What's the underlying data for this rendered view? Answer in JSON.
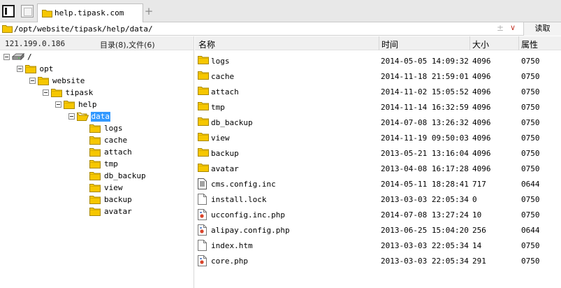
{
  "tab": {
    "title": "help.tipask.com",
    "add_label": "+"
  },
  "address": {
    "path": "/opt/website/tipask/help/data/",
    "pm_icon": "plus-minus-icon",
    "dropdown_icon": "chevron-down-icon",
    "read_label": "读取"
  },
  "left": {
    "ip": "121.199.0.186",
    "counts": "目录(8),文件(6)",
    "tree": [
      {
        "label": "/",
        "level": 0,
        "toggle": true,
        "icon": "drive"
      },
      {
        "label": "opt",
        "level": 1,
        "toggle": true,
        "icon": "folder"
      },
      {
        "label": "website",
        "level": 2,
        "toggle": true,
        "icon": "folder"
      },
      {
        "label": "tipask",
        "level": 3,
        "toggle": true,
        "icon": "folder"
      },
      {
        "label": "help",
        "level": 4,
        "toggle": true,
        "icon": "folder"
      },
      {
        "label": "data",
        "level": 5,
        "toggle": true,
        "icon": "folder-open",
        "selected": true
      },
      {
        "label": "logs",
        "level": 6,
        "toggle": false,
        "icon": "folder"
      },
      {
        "label": "cache",
        "level": 6,
        "toggle": false,
        "icon": "folder"
      },
      {
        "label": "attach",
        "level": 6,
        "toggle": false,
        "icon": "folder"
      },
      {
        "label": "tmp",
        "level": 6,
        "toggle": false,
        "icon": "folder"
      },
      {
        "label": "db_backup",
        "level": 6,
        "toggle": false,
        "icon": "folder"
      },
      {
        "label": "view",
        "level": 6,
        "toggle": false,
        "icon": "folder"
      },
      {
        "label": "backup",
        "level": 6,
        "toggle": false,
        "icon": "folder"
      },
      {
        "label": "avatar",
        "level": 6,
        "toggle": false,
        "icon": "folder"
      }
    ]
  },
  "table": {
    "headers": {
      "name": "名称",
      "time": "时间",
      "size": "大小",
      "attr": "属性"
    },
    "rows": [
      {
        "name": "logs",
        "time": "2014-05-05 14:09:32",
        "size": "4096",
        "attr": "0750",
        "icon": "folder"
      },
      {
        "name": "cache",
        "time": "2014-11-18 21:59:01",
        "size": "4096",
        "attr": "0750",
        "icon": "folder"
      },
      {
        "name": "attach",
        "time": "2014-11-02 15:05:52",
        "size": "4096",
        "attr": "0750",
        "icon": "folder"
      },
      {
        "name": "tmp",
        "time": "2014-11-14 16:32:59",
        "size": "4096",
        "attr": "0750",
        "icon": "folder"
      },
      {
        "name": "db_backup",
        "time": "2014-07-08 13:26:32",
        "size": "4096",
        "attr": "0750",
        "icon": "folder"
      },
      {
        "name": "view",
        "time": "2014-11-19 09:50:03",
        "size": "4096",
        "attr": "0750",
        "icon": "folder"
      },
      {
        "name": "backup",
        "time": "2013-05-21 13:16:04",
        "size": "4096",
        "attr": "0750",
        "icon": "folder"
      },
      {
        "name": "avatar",
        "time": "2013-04-08 16:17:28",
        "size": "4096",
        "attr": "0750",
        "icon": "folder"
      },
      {
        "name": "cms.config.inc",
        "time": "2014-05-11 18:28:41",
        "size": "717",
        "attr": "0644",
        "icon": "config-file"
      },
      {
        "name": "install.lock",
        "time": "2013-03-03 22:05:34",
        "size": "0",
        "attr": "0750",
        "icon": "blank-file"
      },
      {
        "name": "ucconfig.inc.php",
        "time": "2014-07-08 13:27:24",
        "size": "10",
        "attr": "0750",
        "icon": "php-file"
      },
      {
        "name": "alipay.config.php",
        "time": "2013-06-25 15:04:20",
        "size": "256",
        "attr": "0644",
        "icon": "php-file"
      },
      {
        "name": "index.htm",
        "time": "2013-03-03 22:05:34",
        "size": "14",
        "attr": "0750",
        "icon": "blank-file"
      },
      {
        "name": "core.php",
        "time": "2013-03-03 22:05:34",
        "size": "291",
        "attr": "0750",
        "icon": "php-file"
      }
    ]
  },
  "colors": {
    "folder": "#f6c700",
    "folder_edge": "#a88700",
    "selection": "#3399ff",
    "dropdown": "#c43a2c"
  }
}
